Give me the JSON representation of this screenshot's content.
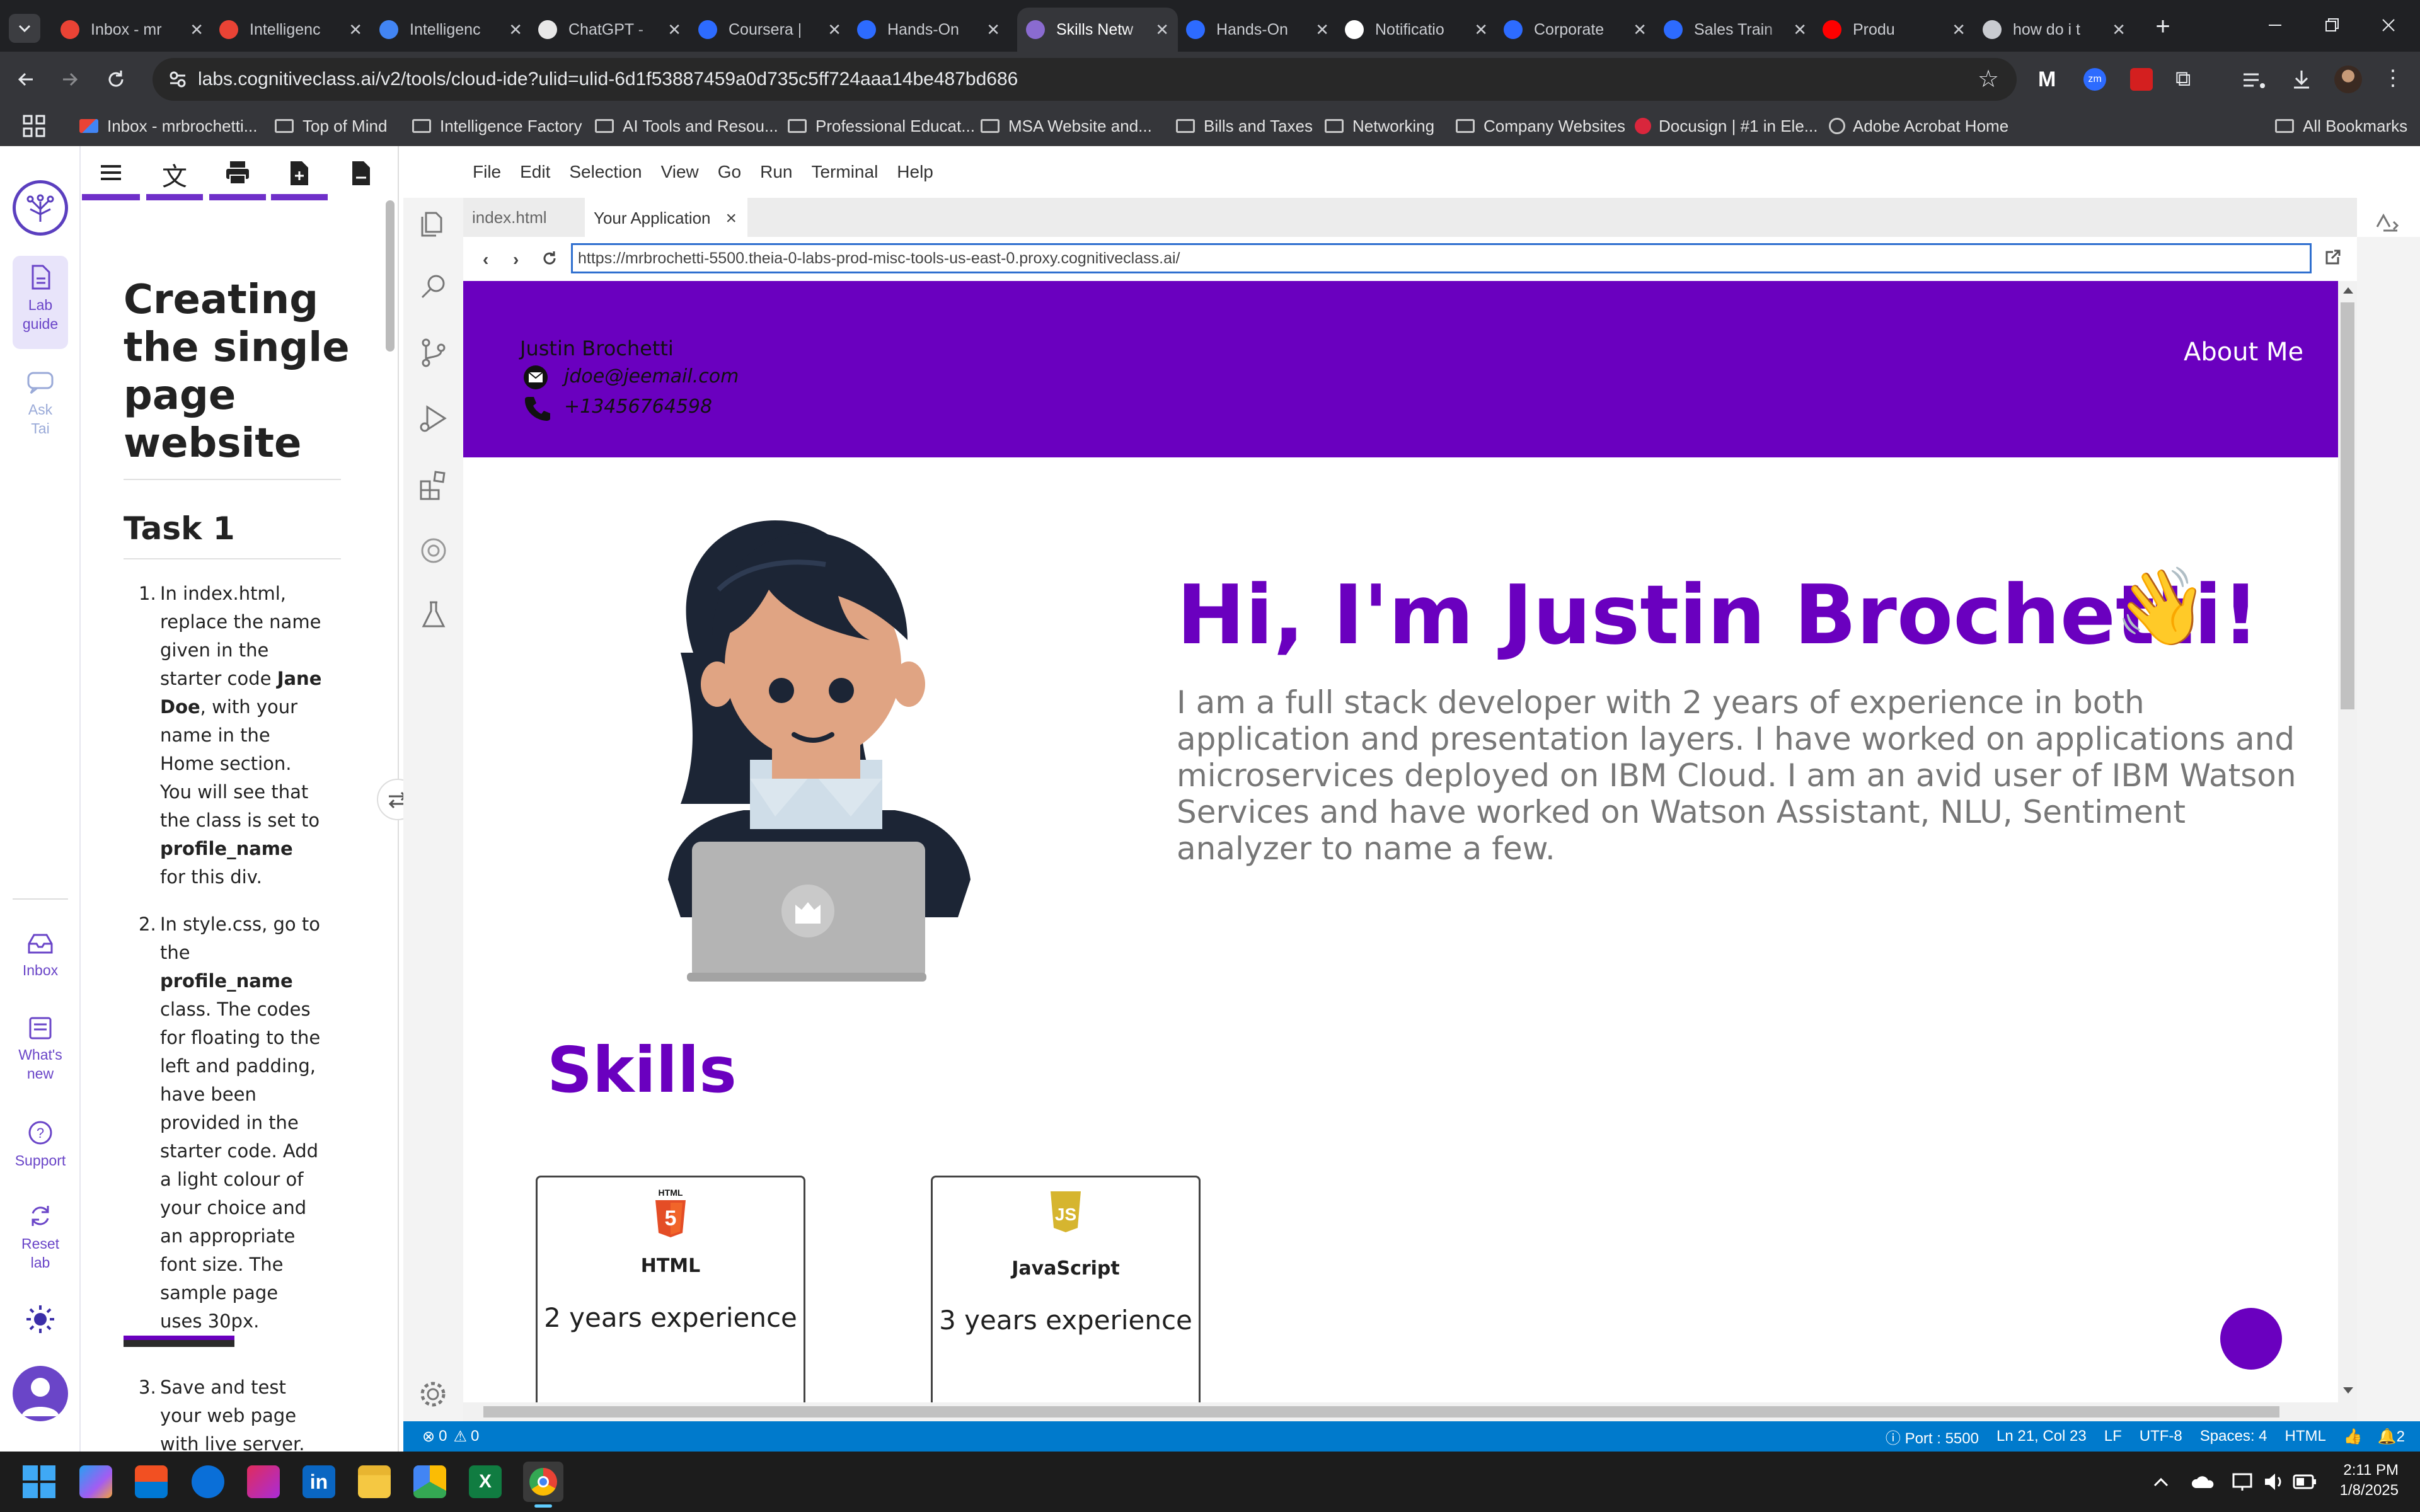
{
  "browser": {
    "tabs": [
      {
        "title": "Inbox - mr",
        "favicon": "gmail-icon",
        "color": "#ea4335"
      },
      {
        "title": "Intelligenc",
        "favicon": "gmail-icon",
        "color": "#ea4335"
      },
      {
        "title": "Intelligenc",
        "favicon": "docs-icon",
        "color": "#4285f4"
      },
      {
        "title": "ChatGPT -",
        "favicon": "chatgpt-icon",
        "color": "#e8e8e8"
      },
      {
        "title": "Coursera |",
        "favicon": "coursera-icon",
        "color": "#2d6bff"
      },
      {
        "title": "Hands-On",
        "favicon": "coursera-icon",
        "color": "#2d6bff"
      },
      {
        "title": "Skills Netw",
        "favicon": "skills-icon",
        "color": "#8a6bd0"
      },
      {
        "title": "Hands-On",
        "favicon": "coursera-icon",
        "color": "#2d6bff"
      },
      {
        "title": "Notificatio",
        "favicon": "x-icon",
        "color": "#ffffff"
      },
      {
        "title": "Corporate",
        "favicon": "coursera-icon",
        "color": "#2d6bff"
      },
      {
        "title": "Sales Train",
        "favicon": "coursera-icon",
        "color": "#2d6bff"
      },
      {
        "title": "Produ",
        "favicon": "youtube-icon",
        "color": "#ff0000"
      },
      {
        "title": "how do i t",
        "favicon": "globe-icon",
        "color": "#c9cbd0"
      }
    ],
    "url": "labs.cognitiveclass.ai/v2/tools/cloud-ide?ulid=ulid-6d1f53887459a0d735c5ff724aaa14be487bd686",
    "bookmarks": [
      "Inbox - mrbrochetti...",
      "Top of Mind",
      "Intelligence Factory",
      "AI Tools and Resou...",
      "Professional Educat...",
      "MSA Website and...",
      "Bills and Taxes",
      "Networking",
      "Company Websites",
      "Docusign | #1 in Ele...",
      "Adobe Acrobat Home"
    ],
    "all_bookmarks": "All Bookmarks"
  },
  "lab": {
    "rail": {
      "lab_guide": [
        "Lab",
        "guide"
      ],
      "ask_tai": [
        "Ask",
        "Tai"
      ],
      "inbox": "Inbox",
      "whats_new": [
        "What's",
        "new"
      ],
      "support": "Support",
      "reset_lab": [
        "Reset",
        "lab"
      ]
    },
    "guide": {
      "title_lines": [
        "Creating",
        "the single",
        "page",
        "website"
      ],
      "task": "Task 1",
      "step1": {
        "num": "1.",
        "a": "In index.html, replace the name given in the starter code ",
        "b": "Jane Doe",
        "c": ", with your name in the Home section. You will see that the class is set to ",
        "d": "profile_name",
        "e": " for this div."
      },
      "step2": {
        "num": "2.",
        "a": "In style.css, go to the ",
        "b": "profile_name",
        "c": " class. The codes for floating to the left and padding, have been provided in the starter code. Add a light colour of your choice and an appropriate font size. The sample page uses 30px."
      },
      "step3": {
        "num": "3.",
        "text": "Save and test your web page with live server."
      }
    }
  },
  "ide": {
    "menu": [
      "File",
      "Edit",
      "Selection",
      "View",
      "Go",
      "Run",
      "Terminal",
      "Help"
    ],
    "tabs": [
      "index.html",
      "Your Application"
    ],
    "preview_url": "https://mrbrochetti-5500.theia-0-labs-prod-misc-tools-us-east-0.proxy.cognitiveclass.ai/",
    "status": {
      "problems": "0",
      "warnings": "0",
      "port": "Port : 5500",
      "cursor": "Ln 21, Col 23",
      "eol": "LF",
      "encoding": "UTF-8",
      "indent": "Spaces: 4",
      "language": "HTML",
      "notifications": "2"
    }
  },
  "website": {
    "name": "Justin Brochetti",
    "email": "jdoe@jeemail.com",
    "phone": "+13456764598",
    "nav": "About Me",
    "headline": "Hi, I'm Justin Brochetti!",
    "wave": "👋",
    "bio": "I am a full stack developer with 2 years of experience in both application and presentation layers. I have worked on applications and microservices deployed on IBM Cloud. I am an avid user of IBM Watson Services and have worked on Watson Assistant, NLU, Sentiment analyzer to name a few.",
    "skills_title": "Skills",
    "skills": [
      {
        "name": "HTML",
        "logo_text": "HTML",
        "experience": "2 years experience"
      },
      {
        "name": "JavaScript",
        "logo_text": "JS",
        "experience": "3 years experience"
      }
    ],
    "colors": {
      "primary": "#6a00bf",
      "bio_text": "#777777"
    }
  },
  "taskbar": {
    "time": "2:11 PM",
    "date": "1/8/2025"
  }
}
